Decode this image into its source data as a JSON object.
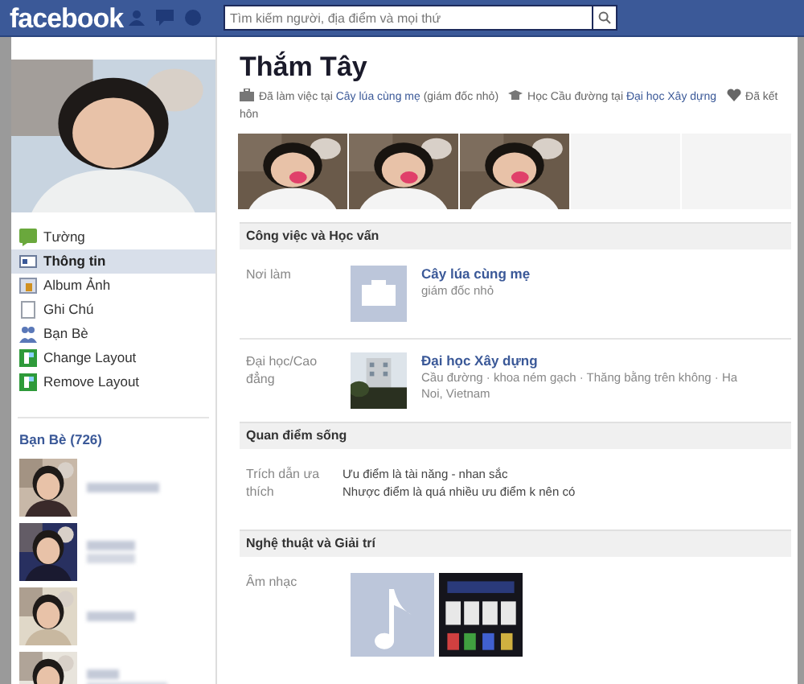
{
  "header": {
    "logo": "facebook",
    "search": {
      "placeholder": "Tìm kiếm người, địa điểm và mọi thứ"
    }
  },
  "sidebar": {
    "profile_photo": {
      "kind": "picture"
    },
    "nav": [
      {
        "label": "Tường",
        "kind": "wall",
        "selected": false
      },
      {
        "label": "Thông tin",
        "kind": "info",
        "selected": true
      },
      {
        "label": "Album Ảnh",
        "kind": "album",
        "selected": false
      },
      {
        "label": "Ghi Chú",
        "kind": "note",
        "selected": false
      },
      {
        "label": "Bạn Bè",
        "kind": "friends",
        "selected": false
      },
      {
        "label": "Change Layout",
        "kind": "app",
        "selected": false
      },
      {
        "label": "Remove Layout",
        "kind": "app",
        "selected": false
      }
    ],
    "friends": {
      "title": "Bạn Bè (726)",
      "items": [
        {
          "kind": "picture"
        },
        {
          "kind": "picture"
        },
        {
          "kind": "picture"
        },
        {
          "kind": "picture"
        }
      ]
    }
  },
  "profile": {
    "name": "Thắm Tây",
    "intro": [
      {
        "kind": "work",
        "parts": [
          {
            "text": "Đã làm việc tại ",
            "link": false
          },
          {
            "text": "Cây lúa cùng mẹ",
            "link": true
          },
          {
            "text": " (giám đốc nhỏ)",
            "link": false
          }
        ]
      },
      {
        "kind": "school",
        "parts": [
          {
            "text": "Học Cầu đường tại ",
            "link": false
          },
          {
            "text": "Đại học Xây dựng",
            "link": true
          }
        ]
      },
      {
        "kind": "relationship",
        "parts": [
          {
            "text": "Đã kết hôn",
            "link": false
          }
        ]
      }
    ],
    "photos": [
      {
        "kind": "picture"
      },
      {
        "kind": "picture"
      },
      {
        "kind": "picture"
      },
      {
        "kind": "empty"
      },
      {
        "kind": "empty"
      }
    ]
  },
  "sections": [
    {
      "title": "Công việc và Học vấn",
      "rows": [
        {
          "kind": "work",
          "label": "Nơi làm",
          "title": "Cây lúa cùng mẹ",
          "subtitle": "giám đốc nhỏ"
        },
        {
          "kind": "school",
          "label": "Đại học/Cao đẳng",
          "title": "Đại học Xây dựng",
          "subtitle": "Cầu đường · khoa ném gạch · Thăng bằng trên không · Ha Noi, Vietnam"
        }
      ]
    },
    {
      "title": "Quan điểm sống",
      "rows": [
        {
          "kind": "quote",
          "label": "Trích dẫn ưa thích",
          "lines": [
            "Ưu điểm là tài năng - nhan sắc",
            "Nhược điểm là quá nhiều ưu điểm k nên có"
          ]
        }
      ]
    },
    {
      "title": "Nghệ thuật và Giải trí",
      "rows": [
        {
          "kind": "media",
          "label": "Âm nhạc",
          "items": [
            {
              "kind": "music"
            },
            {
              "kind": "picture"
            }
          ]
        }
      ]
    }
  ]
}
